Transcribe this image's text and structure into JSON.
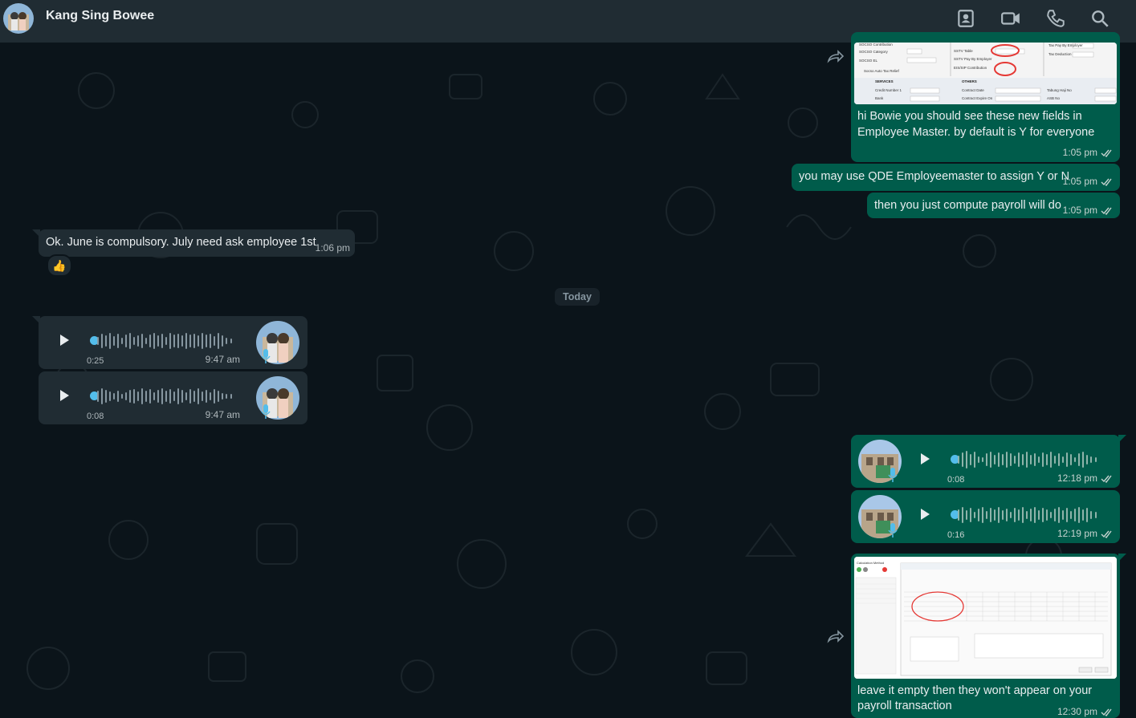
{
  "header": {
    "contact_name": "Kang Sing Bowee",
    "icons": [
      "contacts-icon",
      "video-call-icon",
      "voice-call-icon",
      "search-icon"
    ]
  },
  "colors": {
    "outgoing_bubble": "#005c4b",
    "incoming_bubble": "#202c33",
    "background": "#0b141a",
    "header": "#202c33",
    "voice_dot": "#53bdeb",
    "annotation_red": "#e53935"
  },
  "messages": [
    {
      "id": "m1",
      "direction": "out",
      "type": "image",
      "caption_line1": "hi Bowie you should see these new fields in",
      "caption_line2": "Employee Master. by default is Y for everyone",
      "time": "1:05 pm",
      "status": "read"
    },
    {
      "id": "m2",
      "direction": "out",
      "type": "text",
      "text": "you may use QDE Employeemaster to assign Y or N",
      "time": "1:05 pm",
      "status": "read"
    },
    {
      "id": "m3",
      "direction": "out",
      "type": "text",
      "text": "then you just compute payroll will do",
      "time": "1:05 pm",
      "status": "read"
    },
    {
      "id": "m4",
      "direction": "in",
      "type": "text",
      "text": "Ok. June is compulsory. July need ask employee 1st",
      "time": "1:06 pm",
      "reaction": "👍"
    },
    {
      "id": "m5",
      "direction": "in",
      "type": "voice",
      "duration": "0:25",
      "time": "9:47 am"
    },
    {
      "id": "m6",
      "direction": "in",
      "type": "voice",
      "duration": "0:08",
      "time": "9:47 am"
    },
    {
      "id": "m7",
      "direction": "out",
      "type": "voice",
      "duration": "0:08",
      "time": "12:18 pm",
      "status": "read"
    },
    {
      "id": "m8",
      "direction": "out",
      "type": "voice",
      "duration": "0:16",
      "time": "12:19 pm",
      "status": "read"
    },
    {
      "id": "m9",
      "direction": "out",
      "type": "image",
      "caption_line1": "leave it empty then they won't appear on your",
      "caption_line2": "payroll transaction",
      "time": "12:30 pm",
      "status": "read"
    }
  ],
  "date_divider": "Today",
  "screenshot1_labels": {
    "socso_contribution": "SOCSO Contribution",
    "socso_category": "SOCSO Category",
    "socso_el": "SOCSO EL",
    "socso_auto": "Socso Auto Tax Relief",
    "sstv_table": "SSTV Table",
    "sstv_pay_by": "SSTV Pay By Employer",
    "eis": "EIS/SIP Contribution",
    "tax_pay": "Tax Pay By Employer",
    "tax_deduction": "Tax Deduction",
    "services": "SERVICES",
    "credit_number": "Credit Number 1",
    "bank": "Bank",
    "others": "OTHERS",
    "contract_date": "Contract Date",
    "contract_expire": "Contract Expire On",
    "tabung": "Tabung Haji No",
    "asb": "ASB No"
  },
  "screenshot2_labels": {
    "window_title": "Calculation Method"
  }
}
